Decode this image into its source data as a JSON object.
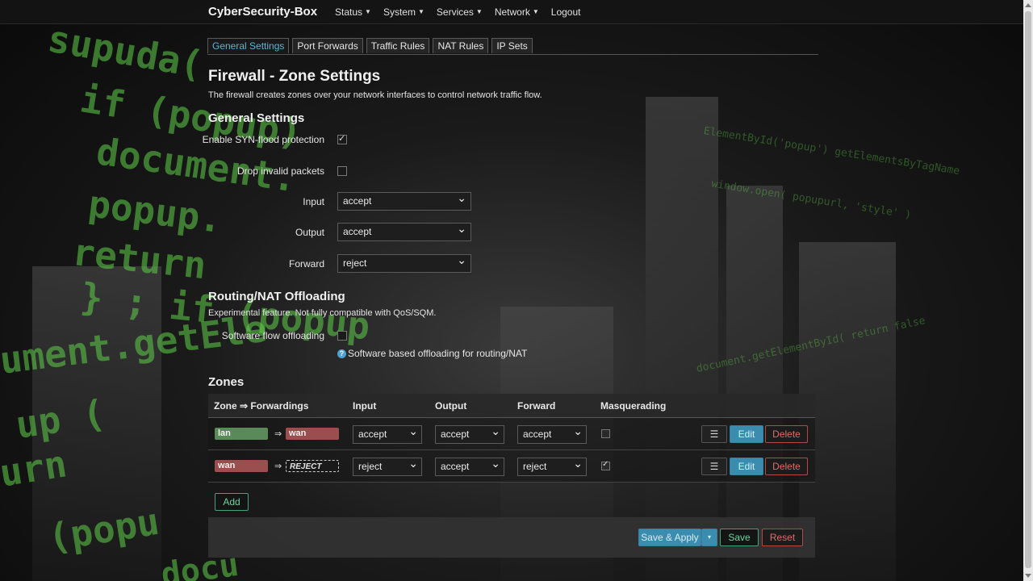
{
  "brand": "CyberSecurity-Box",
  "menu": [
    {
      "label": "Status"
    },
    {
      "label": "System"
    },
    {
      "label": "Services"
    },
    {
      "label": "Network"
    },
    {
      "label": "Logout"
    }
  ],
  "tabs": [
    "General Settings",
    "Port Forwards",
    "Traffic Rules",
    "NAT Rules",
    "IP Sets"
  ],
  "page": {
    "title": "Firewall - Zone Settings",
    "description": "The firewall creates zones over your network interfaces to control network traffic flow."
  },
  "general": {
    "heading": "General Settings",
    "syn_flood_label": "Enable SYN-flood protection",
    "syn_flood_checked": true,
    "drop_invalid_label": "Drop invalid packets",
    "drop_invalid_checked": false,
    "input_label": "Input",
    "input_value": "accept",
    "output_label": "Output",
    "output_value": "accept",
    "forward_label": "Forward",
    "forward_value": "reject"
  },
  "offloading": {
    "heading": "Routing/NAT Offloading",
    "description": "Experimental feature. Not fully compatible with QoS/SQM.",
    "sw_label": "Software flow offloading",
    "sw_checked": false,
    "help_icon": "?",
    "help_text": "Software based offloading for routing/NAT"
  },
  "zones": {
    "heading": "Zones",
    "columns": {
      "zone": "Zone ⇒ Forwardings",
      "input": "Input",
      "output": "Output",
      "forward": "Forward",
      "masq": "Masquerading"
    },
    "arrow": "⇒",
    "rows": [
      {
        "zone": "lan",
        "target": "wan",
        "input": "accept",
        "output": "accept",
        "forward": "accept",
        "masq": false
      },
      {
        "zone": "wan",
        "target": "REJECT",
        "input": "reject",
        "output": "accept",
        "forward": "reject",
        "masq": true
      }
    ],
    "menu_glyph": "☰",
    "edit_label": "Edit",
    "delete_label": "Delete",
    "add_label": "Add"
  },
  "footer": {
    "save_apply": "Save & Apply",
    "save_apply_caret": "▾",
    "save": "Save",
    "reset": "Reset"
  },
  "colors": {
    "accent": "#5ab4d8",
    "lan": "#5a8a5a",
    "wan": "#9a4e4e",
    "code_green": "#5fd04a"
  }
}
